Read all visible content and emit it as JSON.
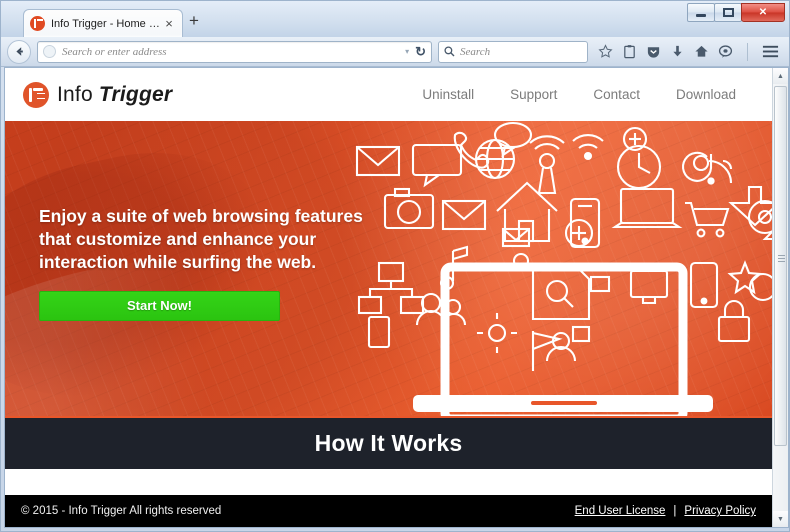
{
  "browser": {
    "tab": {
      "title": "Info Trigger - Home Page",
      "close_label": "×",
      "favicon": "info-trigger-favicon"
    },
    "new_tab_label": "+",
    "window_controls": {
      "minimize": "minimize",
      "maximize": "maximize",
      "close": "✕"
    },
    "back_label": "←",
    "address_bar": {
      "value": "",
      "placeholder": "Search or enter address",
      "dropdown": "▾",
      "reload": "↻"
    },
    "search_box": {
      "value": "",
      "placeholder": "Search",
      "icon": "search-icon"
    },
    "toolbar_icons": [
      "bookmark-star-icon",
      "reader-clipboard-icon",
      "pocket-icon",
      "downloads-icon",
      "home-icon",
      "chat-icon",
      "menu-hamburger-icon"
    ],
    "scrollbar": {
      "up": "▲",
      "down": "▼"
    }
  },
  "site": {
    "logo": {
      "name_regular": "Info",
      "name_bold": "Trigger",
      "mark": "it-monogram-icon"
    },
    "nav": [
      {
        "label": "Uninstall"
      },
      {
        "label": "Support"
      },
      {
        "label": "Contact"
      },
      {
        "label": "Download"
      }
    ],
    "hero": {
      "headline": "Enjoy a suite of web browsing features that customize and enhance your interaction while surfing the web.",
      "cta_label": "Start Now!",
      "illustration": "laptop-with-icon-cloud",
      "bg_color": "#e8562a",
      "cta_color": "#2fd117"
    },
    "section_title": "How It Works",
    "section_bar_color": "#1e222b",
    "footer": {
      "copyright": "© 2015 - Info Trigger All rights reserved",
      "links": [
        {
          "label": "End User License"
        },
        {
          "label": "Privacy Policy"
        }
      ],
      "separator": "|"
    }
  }
}
